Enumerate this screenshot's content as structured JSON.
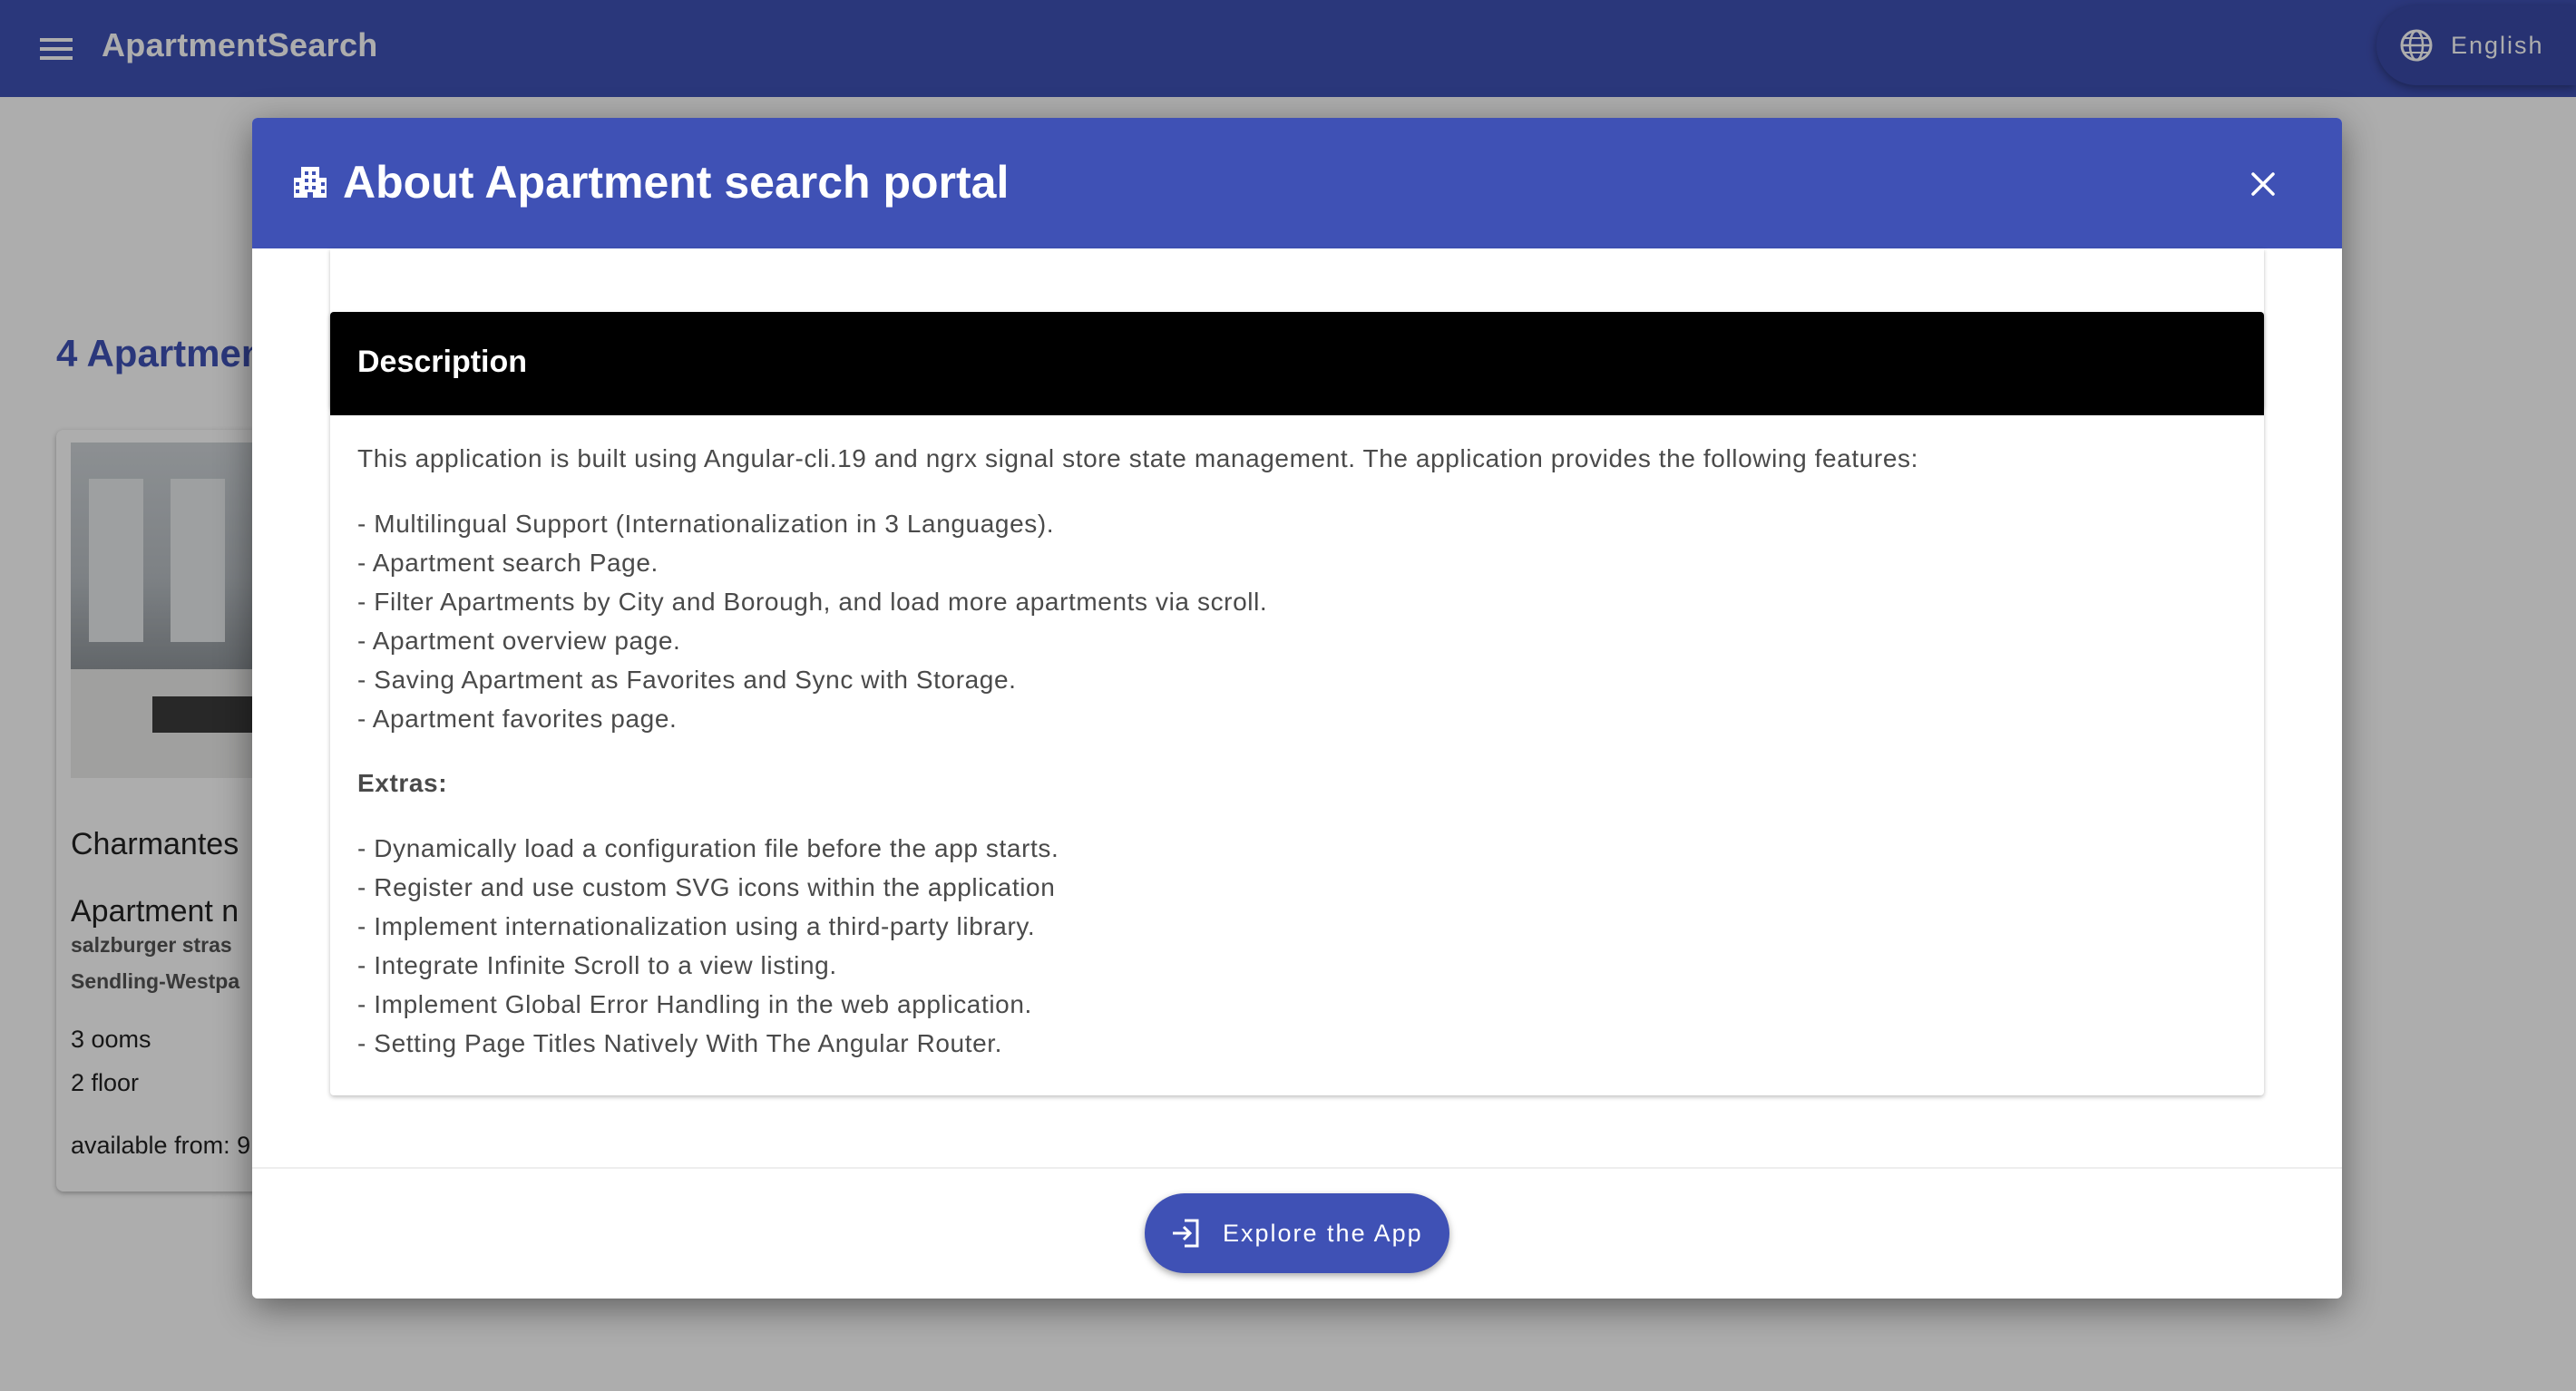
{
  "app_bar": {
    "title": "ApartmentSearch",
    "menu_icon": "menu-icon",
    "language": {
      "icon": "globe-icon",
      "label": "English"
    }
  },
  "background_page": {
    "heading": "4 Apartmen",
    "card": {
      "title": "Charmantes\nApartment n",
      "address_line1": "salzburger stras",
      "address_line2": "Sendling-Westpa",
      "rooms": "3 ooms",
      "floor": "2 floor",
      "available": "available from: 9"
    }
  },
  "dialog": {
    "title_icon": "building-icon",
    "title": "About Apartment search portal",
    "close_icon": "close-icon",
    "description": {
      "header": "Description",
      "intro": "This application is built using Angular-cli.19 and ngrx signal store state management. The application provides the following features:",
      "features": [
        "- Multilingual Support (Internationalization in 3 Languages).",
        "- Apartment search Page.",
        "- Filter Apartments by City and Borough, and load more apartments via scroll.",
        "- Apartment overview page.",
        "- Saving Apartment as Favorites and Sync with Storage.",
        "- Apartment favorites page."
      ],
      "extras_label": "Extras:",
      "extras": [
        "- Dynamically load a configuration file before the app starts.",
        "- Register and use custom SVG icons within the application",
        "- Implement internationalization using a third-party library.",
        "- Integrate Infinite Scroll to a view listing.",
        "- Implement Global Error Handling in the web application.",
        "- Setting Page Titles Natively With The Angular Router."
      ]
    },
    "explore_button": {
      "icon": "login-icon",
      "label": "Explore the App"
    }
  },
  "colors": {
    "primary": "#3f51b5",
    "description_header_bg": "#000000",
    "overlay": "rgba(0,0,0,0.32)"
  }
}
